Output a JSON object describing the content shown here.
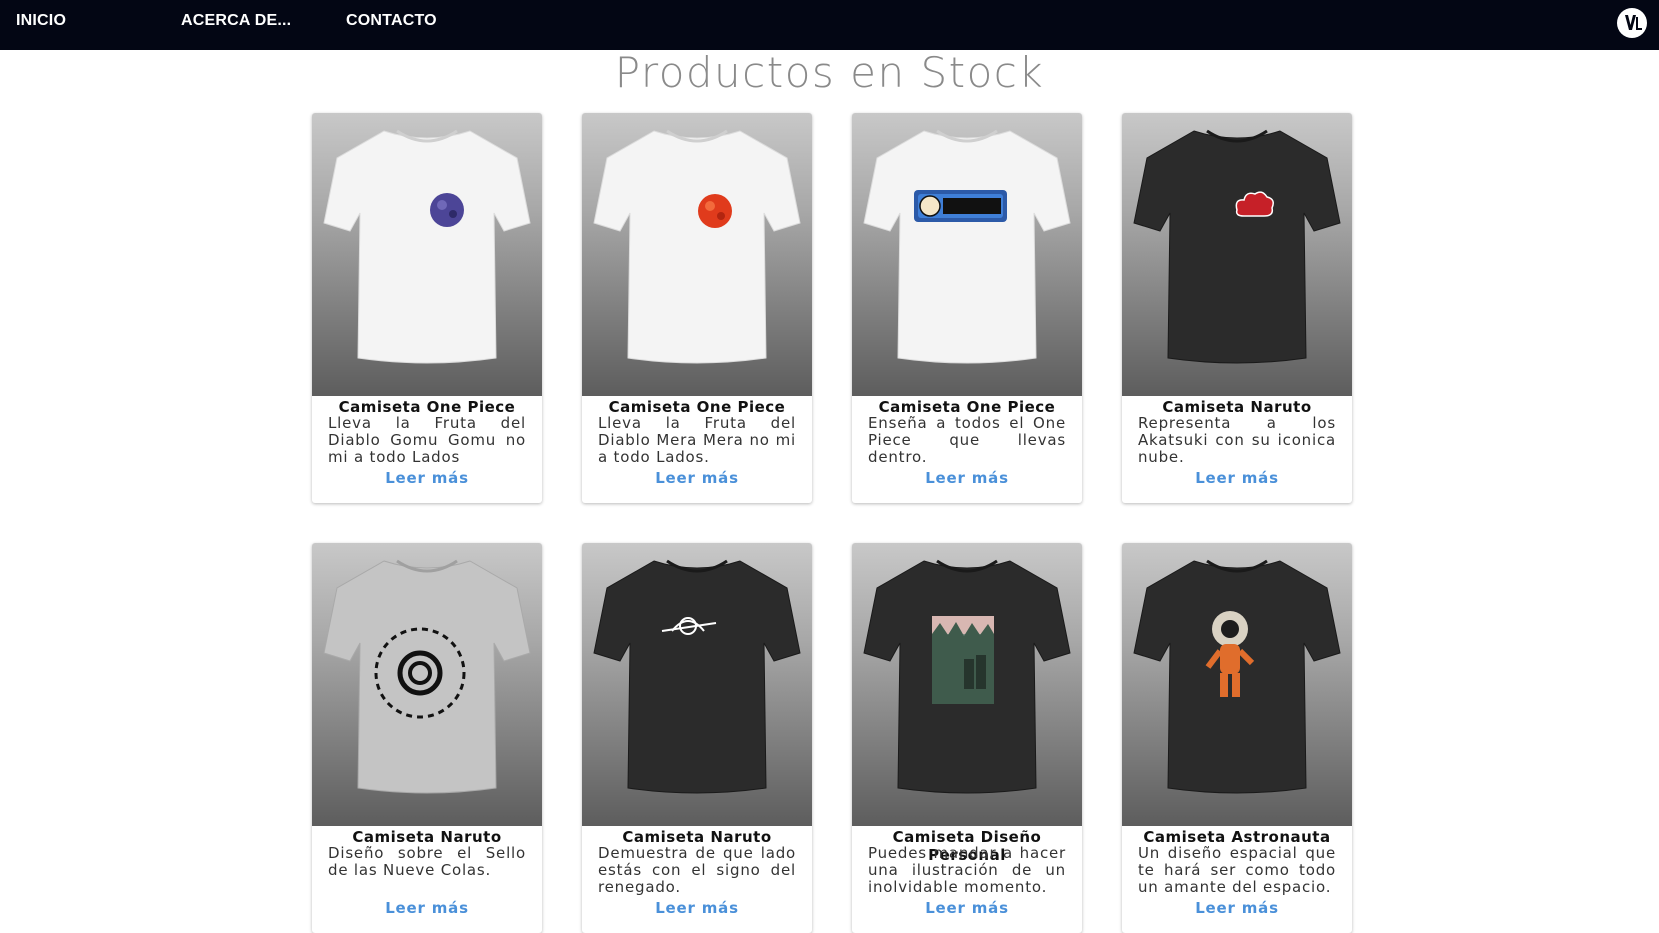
{
  "nav": {
    "items": [
      "INICIO",
      "ACERCA DE...",
      "CONTACTO"
    ]
  },
  "page": {
    "title": "Productos en Stock"
  },
  "colors": {
    "navbar": "#030614",
    "link": "#4a90d9",
    "title": "#8a8a8a"
  },
  "products": [
    {
      "title": "Camiseta One Piece",
      "desc": "Lleva la Fruta del Diablo Gomu Gomu no mi a todo Lados",
      "link": "Leer más",
      "shirt": "white",
      "design": "gomu-fruit"
    },
    {
      "title": "Camiseta One Piece",
      "desc": "Lleva la Fruta del Diablo Mera Mera no mi a todo Lados.",
      "link": "Leer más",
      "shirt": "white",
      "design": "mera-fruit"
    },
    {
      "title": "Camiseta One Piece",
      "desc": "Enseña a todos el One Piece que llevas dentro.",
      "link": "Leer más",
      "shirt": "white",
      "design": "one-piece-logo"
    },
    {
      "title": "Camiseta Naruto",
      "desc": "Representa a los Akatsuki con su iconica nube.",
      "link": "Leer más",
      "shirt": "black",
      "design": "akatsuki-cloud"
    },
    {
      "title": "Camiseta Naruto",
      "desc": "Diseño sobre el Sello de las Nueve Colas.",
      "link": "Leer más",
      "shirt": "gray",
      "design": "nine-tails-seal"
    },
    {
      "title": "Camiseta Naruto",
      "desc": "Demuestra de que lado estás con el signo del renegado.",
      "link": "Leer más",
      "shirt": "black",
      "design": "renegade-leaf"
    },
    {
      "title": "Camiseta Diseño Personal",
      "desc": "Puedes mandar a hacer una ilustración de un inolvidable momento.",
      "link": "Leer más",
      "shirt": "black",
      "design": "forest-illustration"
    },
    {
      "title": "Camiseta Astronauta",
      "desc": "Un diseño espacial que te hará ser como todo un amante del espacio.",
      "link": "Leer más",
      "shirt": "black",
      "design": "astronaut"
    }
  ]
}
